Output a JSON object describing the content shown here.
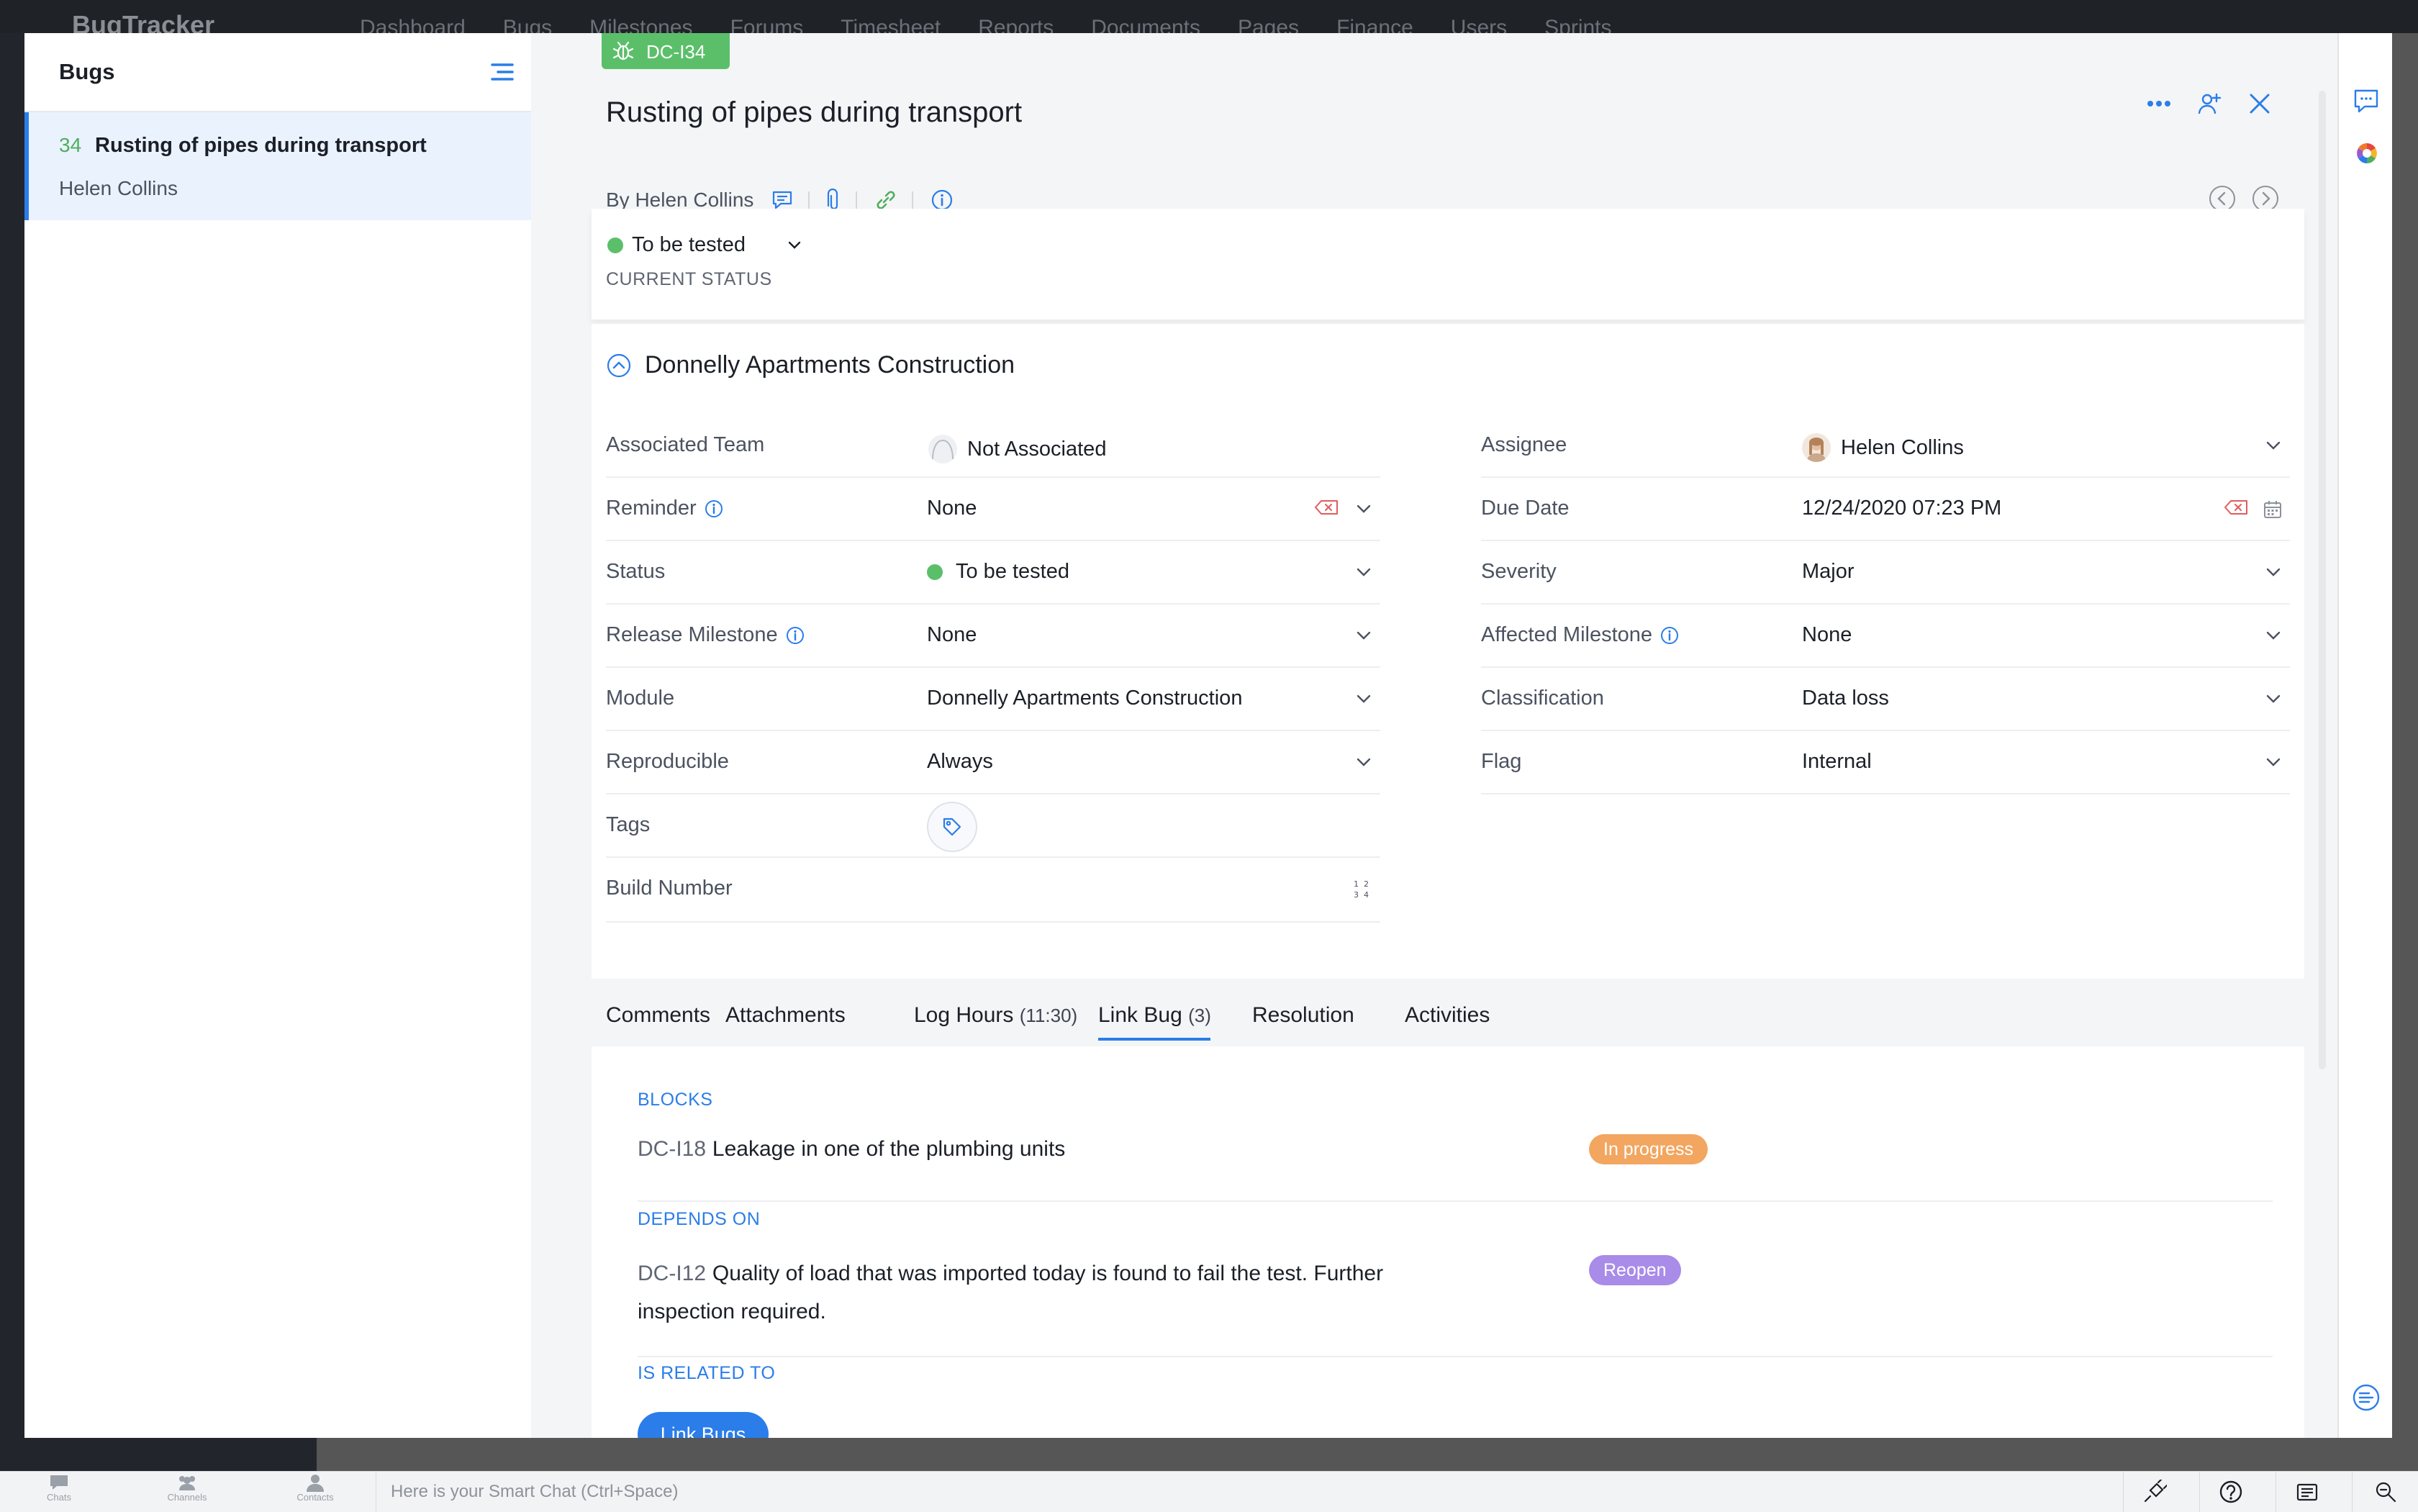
{
  "background_app": {
    "brand": "BugTracker",
    "nav": [
      "Dashboard",
      "Bugs",
      "Milestones",
      "Forums",
      "Timesheet",
      "Reports",
      "Documents",
      "Pages",
      "Finance",
      "Users",
      "Sprints"
    ]
  },
  "list_pane": {
    "title": "Bugs",
    "items": [
      {
        "number": "34",
        "title": "Rusting of pipes during transport",
        "reporter": "Helen Collins"
      }
    ]
  },
  "detail": {
    "bug_id": "DC-I34",
    "title": "Rusting of pipes during transport",
    "reported_by": "By Helen Collins",
    "current_status": {
      "value": "To be tested",
      "label": "CURRENT STATUS",
      "color": "#5bbf6a"
    },
    "section_title": "Donnelly Apartments Construction",
    "fields_left": [
      {
        "label": "Associated Team",
        "value": "Not Associated"
      },
      {
        "label": "Reminder",
        "value": "None"
      },
      {
        "label": "Status",
        "value": "To be tested"
      },
      {
        "label": "Release Milestone",
        "value": "None"
      },
      {
        "label": "Module",
        "value": "Donnelly Apartments Construction"
      },
      {
        "label": "Reproducible",
        "value": "Always"
      },
      {
        "label": "Tags",
        "value": ""
      },
      {
        "label": "Build Number",
        "value": ""
      }
    ],
    "fields_right": [
      {
        "label": "Assignee",
        "value": "Helen Collins"
      },
      {
        "label": "Due Date",
        "value": "12/24/2020 07:23 PM"
      },
      {
        "label": "Severity",
        "value": "Major"
      },
      {
        "label": "Affected Milestone",
        "value": "None"
      },
      {
        "label": "Classification",
        "value": "Data loss"
      },
      {
        "label": "Flag",
        "value": "Internal"
      }
    ],
    "tabs": [
      {
        "label": "Comments",
        "count": ""
      },
      {
        "label": "Attachments",
        "count": ""
      },
      {
        "label": "Log Hours",
        "count": "(11:30)"
      },
      {
        "label": "Link Bug",
        "count": "(3)"
      },
      {
        "label": "Resolution",
        "count": ""
      },
      {
        "label": "Activities",
        "count": ""
      }
    ],
    "active_tab": "Link Bug",
    "link_groups": [
      {
        "heading": "BLOCKS",
        "items": [
          {
            "id": "DC-I18",
            "title": "Leakage in one of the plumbing units",
            "status": "In progress",
            "status_color": "#f2a660"
          }
        ]
      },
      {
        "heading": "DEPENDS ON",
        "items": [
          {
            "id": "DC-I12",
            "title_line1": "Quality of load that was imported today is found to fail the test. Further",
            "title_line2": "inspection required.",
            "status": "Reopen",
            "status_color": "#a98be8"
          }
        ]
      },
      {
        "heading": "IS RELATED TO",
        "items": []
      }
    ],
    "link_button": "Link Bugs"
  },
  "bottom_bar": {
    "items": [
      "Chats",
      "Channels",
      "Contacts"
    ],
    "search_placeholder": "Here is your Smart Chat (Ctrl+Space)"
  },
  "colors": {
    "accent": "#2b7de9",
    "success": "#5bbf6a",
    "danger": "#e25b5b"
  }
}
